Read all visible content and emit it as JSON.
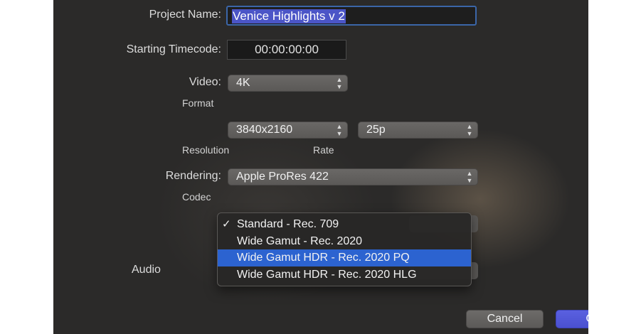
{
  "project_name": {
    "label": "Project Name:",
    "value": "Venice Highlights v 2"
  },
  "starting_timecode": {
    "label": "Starting Timecode:",
    "value": "00:00:00:00"
  },
  "video": {
    "label": "Video:",
    "format": {
      "value": "4K",
      "caption": "Format"
    },
    "resolution": {
      "value": "3840x2160",
      "caption": "Resolution"
    },
    "rate": {
      "value": "25p",
      "caption": "Rate"
    }
  },
  "rendering": {
    "label": "Rendering:",
    "codec": {
      "value": "Apple ProRes 422",
      "caption": "Codec"
    }
  },
  "color_space_menu": {
    "items": [
      {
        "label": "Standard - Rec. 709",
        "checked": true,
        "highlighted": false
      },
      {
        "label": "Wide Gamut - Rec. 2020",
        "checked": false,
        "highlighted": false
      },
      {
        "label": "Wide Gamut HDR - Rec. 2020 PQ",
        "checked": false,
        "highlighted": true
      },
      {
        "label": "Wide Gamut HDR - Rec. 2020 HLG",
        "checked": false,
        "highlighted": false
      }
    ],
    "check_glyph": "✓"
  },
  "audio": {
    "label_visible": "Audio"
  },
  "buttons": {
    "cancel": "Cancel",
    "ok": "OK"
  },
  "colors": {
    "selection": "#4b55c7",
    "menu_highlight": "#2c63d0",
    "ok_button": "#4a50cf"
  }
}
